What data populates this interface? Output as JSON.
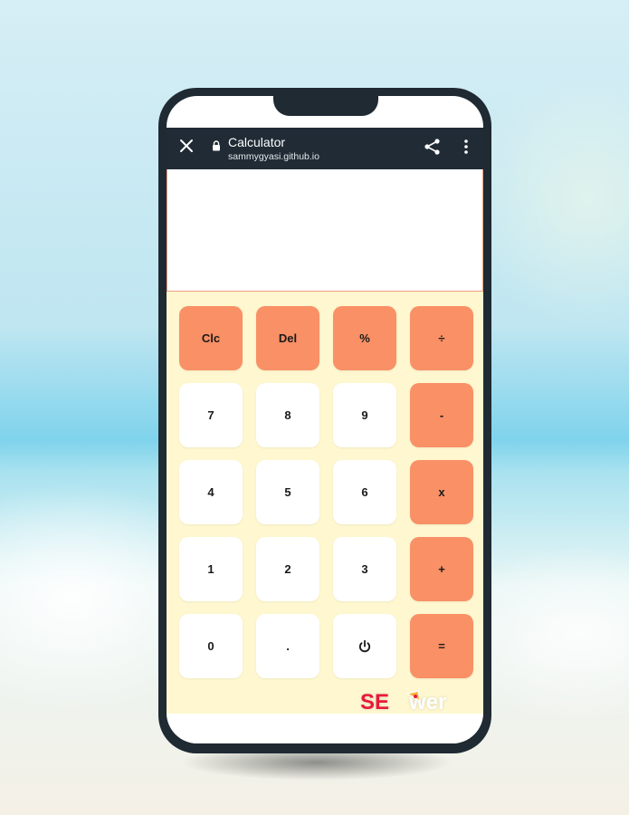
{
  "browser": {
    "title": "Calculator",
    "url": "sammygyasi.github.io",
    "icons": [
      "close-icon",
      "lock-icon",
      "share-icon",
      "more-vert-icon"
    ]
  },
  "display": {
    "value": ""
  },
  "keys": {
    "row1": [
      "Clc",
      "Del",
      "%",
      "÷"
    ],
    "row2": [
      "7",
      "8",
      "9",
      "-"
    ],
    "row3": [
      "4",
      "5",
      "6",
      "x"
    ],
    "row4": [
      "1",
      "2",
      "3",
      "+"
    ],
    "row5": [
      "0",
      ".",
      "power-icon",
      "="
    ]
  },
  "watermark": {
    "prefix": "SE",
    "suffix": "wer"
  },
  "colors": {
    "accent": "#f99066",
    "keypad_background": "#fef7cf",
    "browser_bar": "#202b35"
  }
}
